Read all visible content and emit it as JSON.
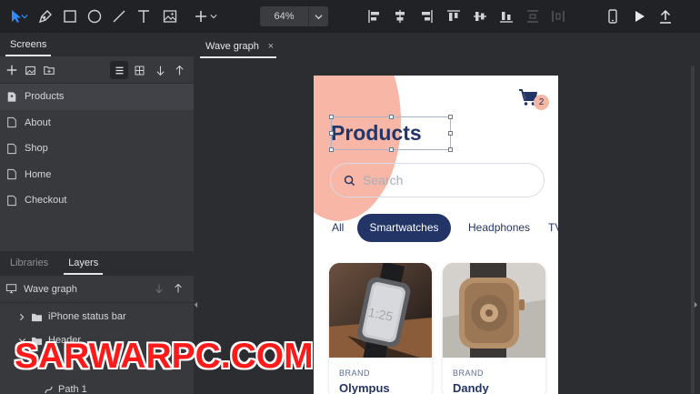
{
  "toolbar": {
    "zoom_value": "64%",
    "tools": [
      "pointer-tool-icon",
      "pen-tool-icon",
      "rectangle-tool-icon",
      "ellipse-tool-icon",
      "line-tool-icon",
      "text-tool-icon",
      "image-tool-icon",
      "add-icon"
    ],
    "align": [
      "align-left-icon",
      "align-center-h-icon",
      "align-right-icon",
      "align-top-icon",
      "align-middle-v-icon",
      "align-bottom-icon",
      "distribute-h-icon",
      "distribute-v-icon"
    ],
    "right": [
      "device-preview-icon",
      "play-icon",
      "export-icon"
    ]
  },
  "left_panel": {
    "tabs": [
      {
        "label": "Screens"
      }
    ],
    "screens": [
      {
        "label": "Products"
      },
      {
        "label": "About"
      },
      {
        "label": "Shop"
      },
      {
        "label": "Home"
      },
      {
        "label": "Checkout"
      }
    ],
    "layers_tabs": [
      {
        "label": "Libraries"
      },
      {
        "label": "Layers"
      }
    ],
    "layers_root": "Wave graph",
    "layers": [
      {
        "label": "iPhone status bar"
      },
      {
        "label": "Header"
      },
      {
        "label": "Path 1"
      }
    ]
  },
  "canvas": {
    "doc_tab": "Wave graph",
    "doc_tab_close": "×"
  },
  "phone": {
    "title": "Products",
    "cart_count": "2",
    "search_placeholder": "Search",
    "chips": [
      {
        "label": "All"
      },
      {
        "label": "Smartwatches"
      },
      {
        "label": "Headphones"
      },
      {
        "label": "TV"
      }
    ],
    "cards": [
      {
        "brand": "BRAND",
        "name": "Olympus",
        "dial_text": "1:25"
      },
      {
        "brand": "BRAND",
        "name": "Dandy"
      }
    ]
  },
  "watermark": "SARWARPC.COM",
  "colors": {
    "accent_navy": "#233566",
    "blob": "#f7b6a6",
    "toolbar_bg": "#212226",
    "panel_bg": "#37393d",
    "watermark_red": "#ff1a1a"
  }
}
